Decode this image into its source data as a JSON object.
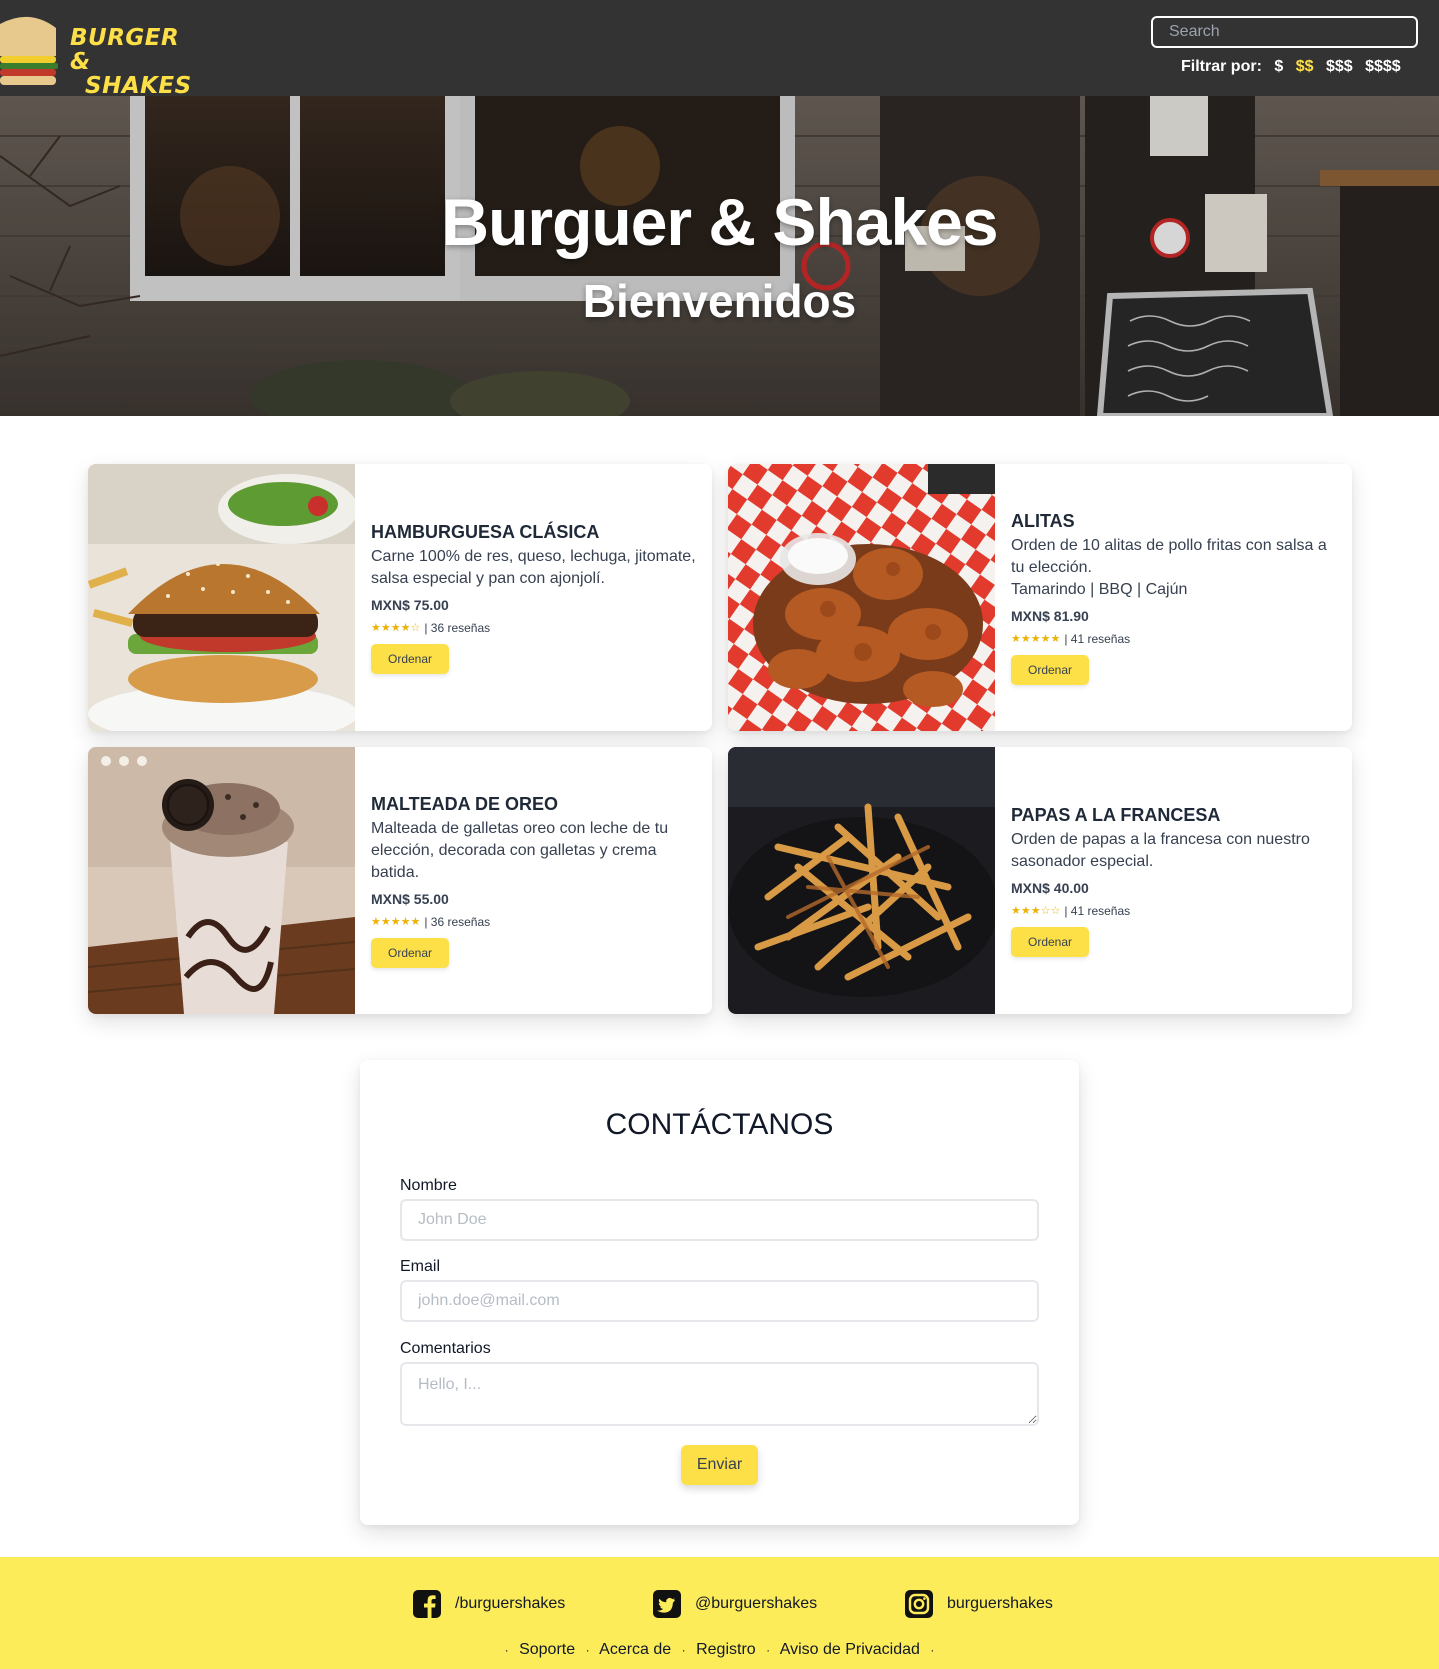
{
  "nav": {
    "logo_line1": "BURGER &",
    "logo_line2": "SHAKES",
    "search_placeholder": "Search",
    "filter_label": "Filtrar por:",
    "filter_options": [
      "$",
      "$$",
      "$$$",
      "$$$$"
    ],
    "filter_selected": "$$"
  },
  "hero": {
    "title": "Burguer & Shakes",
    "subtitle": "Bienvenidos"
  },
  "products": [
    {
      "name": "HAMBURGUESA CLÁSICA",
      "description": "Carne 100% de res, queso, lechuga, jitomate, salsa especial y pan con ajonjolí.",
      "extra": "",
      "price": "MXN$ 75.00",
      "stars": "★★★★☆",
      "rating": 4,
      "reviews": "| 36 reseñas",
      "button": "Ordenar"
    },
    {
      "name": "ALITAS",
      "description": "Orden de 10 alitas de pollo fritas con salsa a tu elección.",
      "extra": "Tamarindo | BBQ | Cajún",
      "price": "MXN$ 81.90",
      "stars": "★★★★★",
      "rating": 5,
      "reviews": "| 41 reseñas",
      "button": "Ordenar"
    },
    {
      "name": "MALTEADA DE OREO",
      "description": "Malteada de galletas oreo con leche de tu elección, decorada con galletas y crema batida.",
      "extra": "",
      "price": "MXN$ 55.00",
      "stars": "★★★★★",
      "rating": 5,
      "reviews": "| 36 reseñas",
      "button": "Ordenar"
    },
    {
      "name": "PAPAS A LA FRANCESA",
      "description": "Orden de papas a la francesa con nuestro sasonador especial.",
      "extra": "",
      "price": "MXN$ 40.00",
      "stars": "★★★☆☆",
      "rating": 3,
      "reviews": "| 41 reseñas",
      "button": "Ordenar"
    }
  ],
  "contact": {
    "title": "CONTÁCTANOS",
    "name_label": "Nombre",
    "name_placeholder": "John Doe",
    "email_label": "Email",
    "email_placeholder": "john.doe@mail.com",
    "comments_label": "Comentarios",
    "comments_placeholder": "Hello, I...",
    "submit": "Enviar"
  },
  "footer": {
    "facebook": "/burguershakes",
    "twitter": "@burguershakes",
    "instagram": "burguershakes",
    "links": [
      "Soporte",
      "Acerca de",
      "Registro",
      "Aviso de Privacidad"
    ]
  },
  "colors": {
    "accent": "#fde047",
    "navbar": "#333333",
    "footer": "#fdec5a"
  }
}
